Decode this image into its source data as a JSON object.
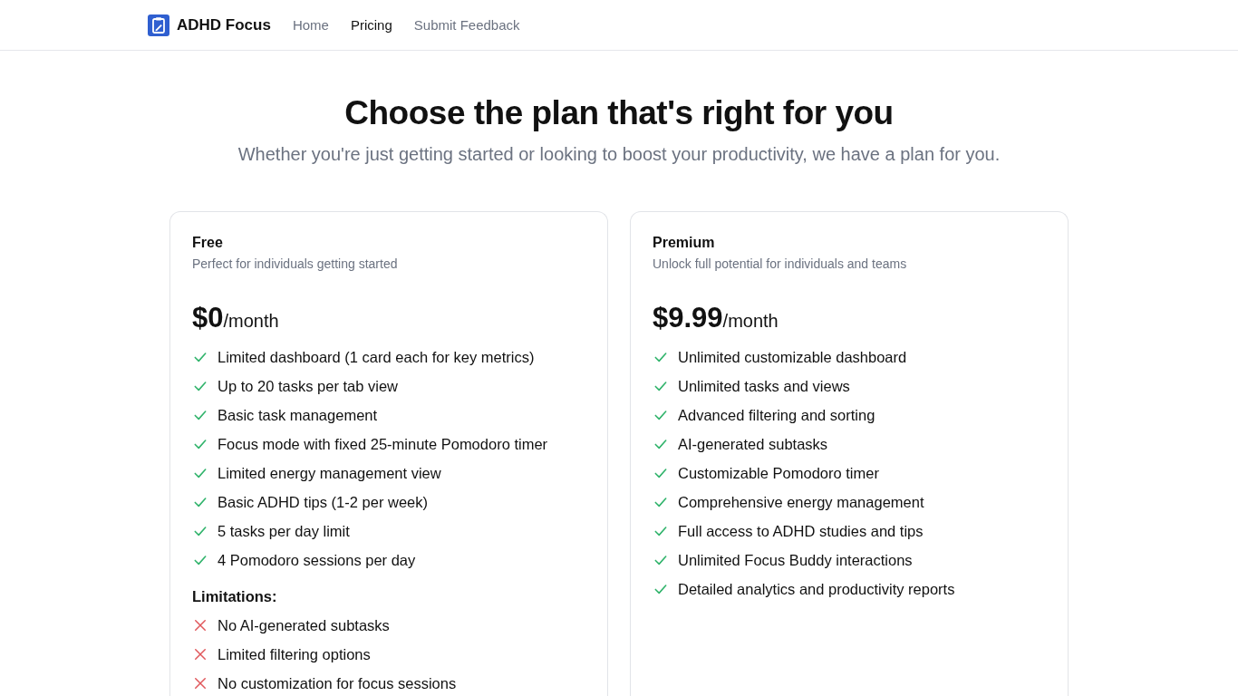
{
  "nav": {
    "brand": "ADHD Focus",
    "links": [
      {
        "label": "Home",
        "selected": false
      },
      {
        "label": "Pricing",
        "selected": true
      },
      {
        "label": "Submit Feedback",
        "selected": false
      }
    ]
  },
  "hero": {
    "title": "Choose the plan that's right for you",
    "subtitle": "Whether you're just getting started or looking to boost your productivity, we have a plan for you."
  },
  "plans": [
    {
      "name": "Free",
      "description": "Perfect for individuals getting started",
      "price": "$0",
      "period": "/month",
      "features": [
        "Limited dashboard (1 card each for key metrics)",
        "Up to 20 tasks per tab view",
        "Basic task management",
        "Focus mode with fixed 25-minute Pomodoro timer",
        "Limited energy management view",
        "Basic ADHD tips (1-2 per week)",
        "5 tasks per day limit",
        "4 Pomodoro sessions per day"
      ],
      "limitations_heading": "Limitations:",
      "limitations": [
        "No AI-generated subtasks",
        "Limited filtering options",
        "No customization for focus sessions"
      ]
    },
    {
      "name": "Premium",
      "description": "Unlock full potential for individuals and teams",
      "price": "$9.99",
      "period": "/month",
      "features": [
        "Unlimited customizable dashboard",
        "Unlimited tasks and views",
        "Advanced filtering and sorting",
        "AI-generated subtasks",
        "Customizable Pomodoro timer",
        "Comprehensive energy management",
        "Full access to ADHD studies and tips",
        "Unlimited Focus Buddy interactions",
        "Detailed analytics and productivity reports"
      ]
    }
  ]
}
